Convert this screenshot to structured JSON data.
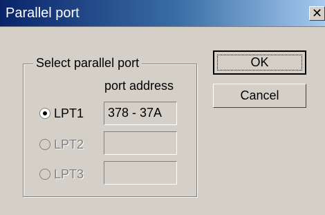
{
  "window": {
    "title": "Parallel port"
  },
  "group": {
    "legend": "Select parallel port",
    "address_header": "port address"
  },
  "ports": [
    {
      "label": "LPT1",
      "address": "378 - 37A",
      "selected": true,
      "enabled": true
    },
    {
      "label": "LPT2",
      "address": "",
      "selected": false,
      "enabled": false
    },
    {
      "label": "LPT3",
      "address": "",
      "selected": false,
      "enabled": false
    }
  ],
  "buttons": {
    "ok": "OK",
    "cancel": "Cancel"
  },
  "icons": {
    "close": "close-icon"
  },
  "colors": {
    "titlebar_start": "#0a246a",
    "titlebar_end": "#a6caf0",
    "face": "#d4d0c8"
  }
}
